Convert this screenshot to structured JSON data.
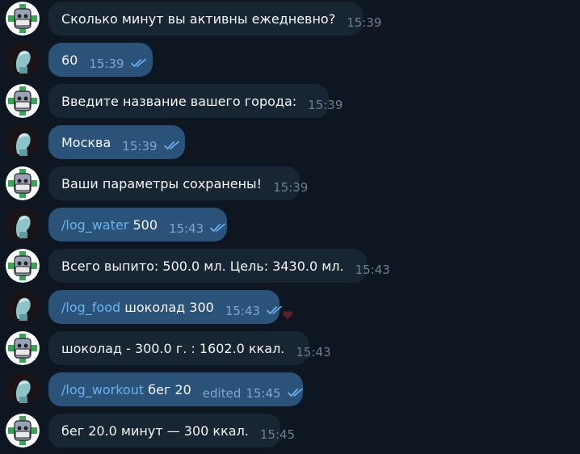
{
  "colors": {
    "background": "#0e1621",
    "incoming_bubble": "#182533",
    "outgoing_bubble": "#2b5278",
    "command_link": "#6ab3f3",
    "checkmarks": "#6ab3f3"
  },
  "messages": [
    {
      "side": "in",
      "avatar": "bot-avatar",
      "text": "Сколько минут вы активны ежедневно?",
      "time": "15:39"
    },
    {
      "side": "out",
      "avatar": "user-avatar",
      "text": "60",
      "time": "15:39",
      "status_icon": "double-check-icon"
    },
    {
      "side": "in",
      "avatar": "bot-avatar",
      "text": "Введите название вашего города:",
      "time": "15:39"
    },
    {
      "side": "out",
      "avatar": "user-avatar",
      "text": "Москва",
      "time": "15:39",
      "status_icon": "double-check-icon"
    },
    {
      "side": "in",
      "avatar": "bot-avatar",
      "text": "Ваши параметры сохранены!",
      "time": "15:39"
    },
    {
      "side": "out",
      "avatar": "user-avatar",
      "command": "/log_water",
      "text": " 500",
      "time": "15:43",
      "status_icon": "double-check-icon"
    },
    {
      "side": "in",
      "avatar": "bot-avatar",
      "text": "Всего выпито: 500.0 мл. Цель: 3430.0 мл.",
      "time": "15:43"
    },
    {
      "side": "out",
      "avatar": "user-avatar",
      "command": "/log_food",
      "text": " шоколад 300",
      "time": "15:43",
      "status_icon": "double-check-icon",
      "reaction_icon": "heart-icon"
    },
    {
      "side": "in",
      "avatar": "bot-avatar",
      "text": "шоколад - 300.0 г. : 1602.0 ккал.",
      "time": "15:43"
    },
    {
      "side": "out",
      "avatar": "user-avatar",
      "command": "/log_workout",
      "text": " бег 20",
      "edited": "edited",
      "time": "15:45",
      "status_icon": "double-check-icon"
    },
    {
      "side": "in",
      "avatar": "bot-avatar",
      "text": "бег 20.0 минут — 300 ккал.",
      "time": "15:45"
    }
  ]
}
